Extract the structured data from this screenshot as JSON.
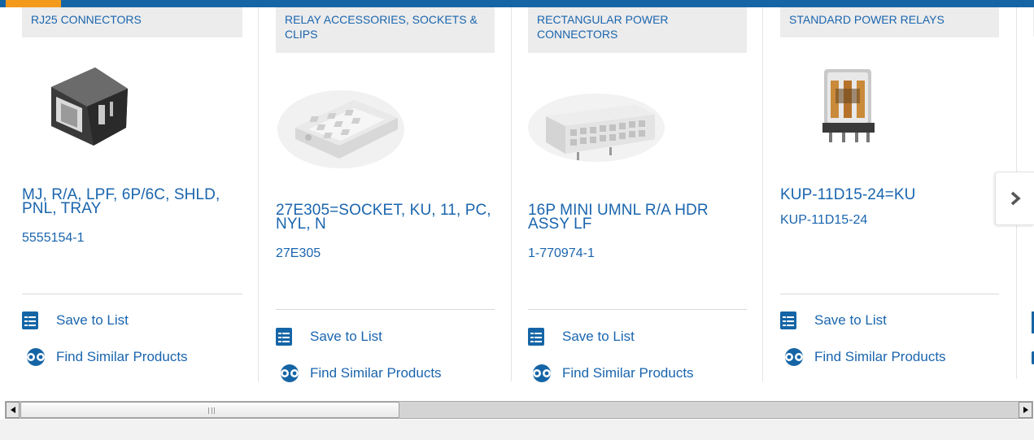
{
  "carousel": {
    "cards": [
      {
        "category": "RJ25 CONNECTORS",
        "title": "MJ, R/A, LPF, 6P/6C, SHLD, PNL, TRAY",
        "part_number": "5555154-1",
        "image_icon": "rj25-connector-image"
      },
      {
        "category": "RELAY ACCESSORIES, SOCKETS & CLIPS",
        "title": "27E305=SOCKET, KU, 11, PC, NYL, N",
        "part_number": "27E305",
        "image_icon": "relay-socket-image"
      },
      {
        "category": "RECTANGULAR POWER CONNECTORS",
        "title": "16P MINI UMNL R/A HDR ASSY LF",
        "part_number": "1-770974-1",
        "image_icon": "power-connector-image"
      },
      {
        "category": "STANDARD POWER RELAYS",
        "title": "KUP-11D15-24=KU",
        "part_number": "KUP-11D15-24",
        "image_icon": "power-relay-image"
      }
    ],
    "actions": {
      "save_label": "Save to List",
      "similar_label": "Find Similar Products"
    },
    "next_icon": "chevron-right-icon"
  },
  "scrollbar": {
    "left_icon": "arrow-left-icon",
    "right_icon": "arrow-right-icon"
  },
  "colors": {
    "brand_blue": "#1565a6",
    "accent_orange": "#f39a1c",
    "badge_gray": "#ececec"
  }
}
